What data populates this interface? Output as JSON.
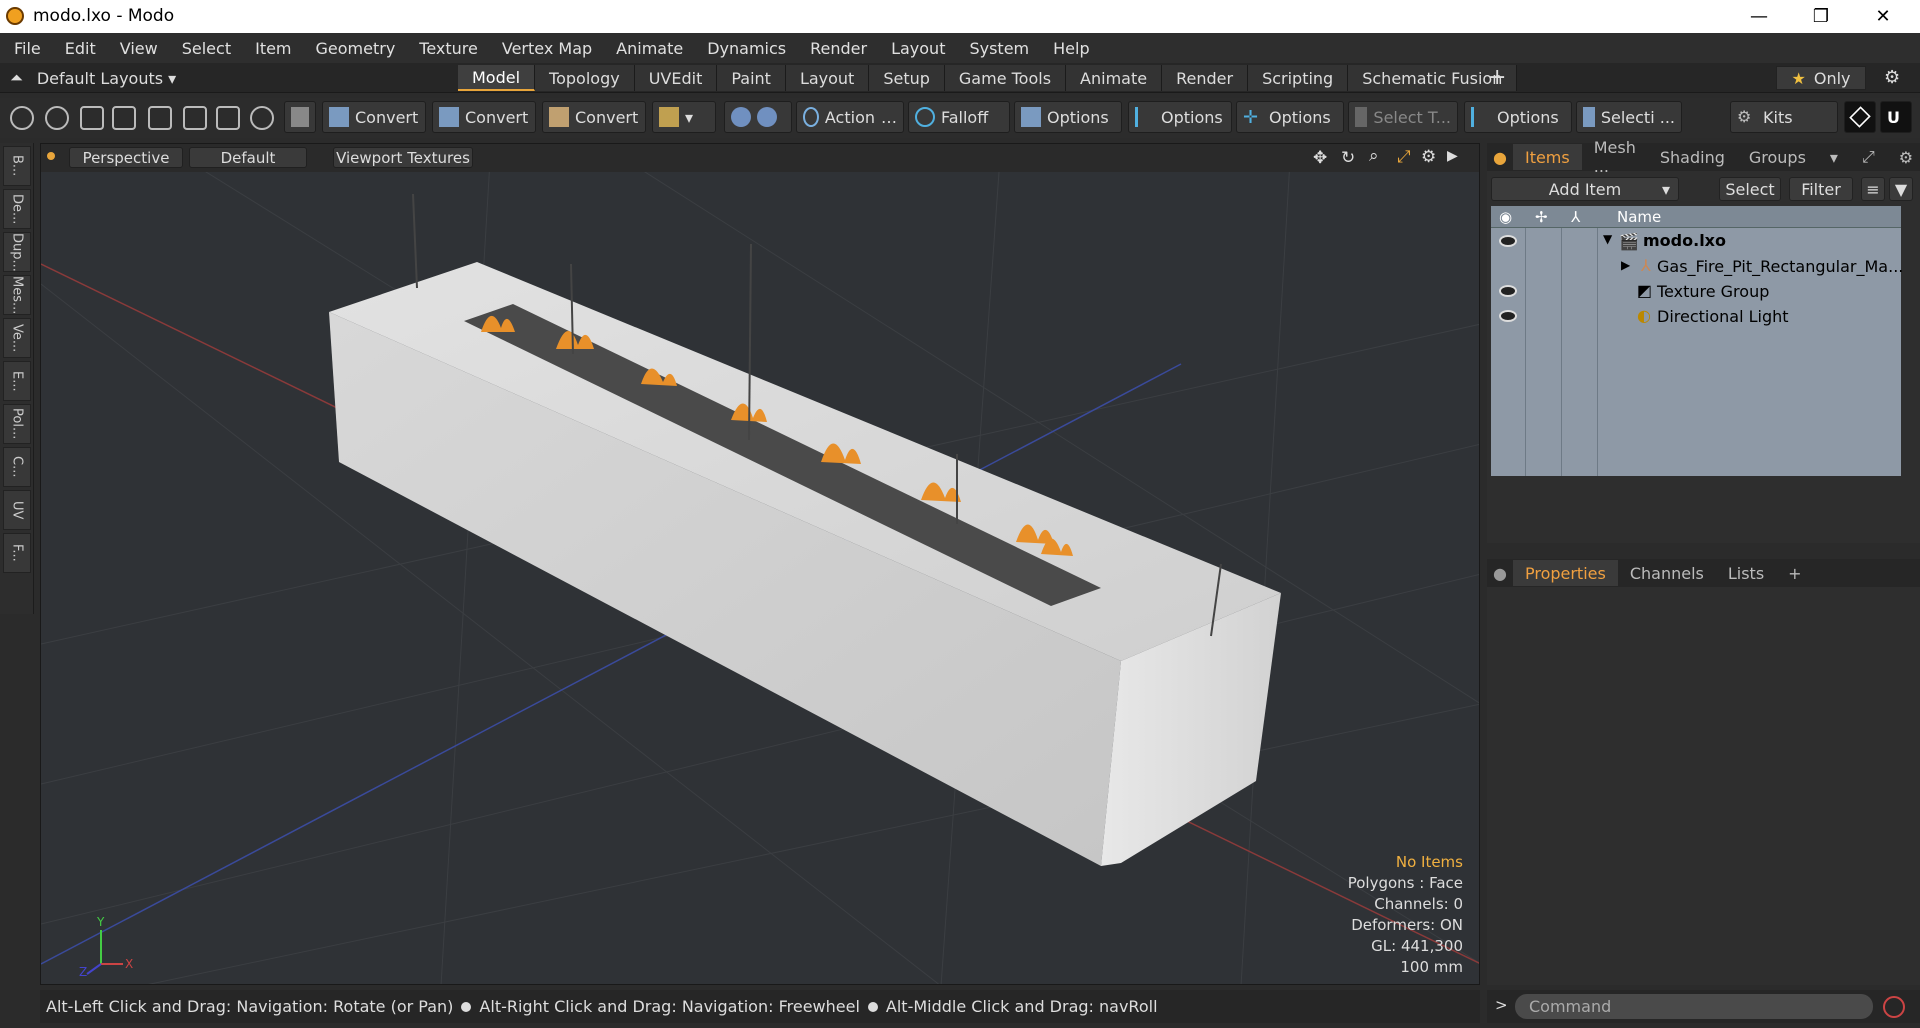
{
  "window": {
    "title": "modo.lxo - Modo",
    "minimize": "—",
    "maximize": "❐",
    "close": "✕"
  },
  "menu": [
    "File",
    "Edit",
    "View",
    "Select",
    "Item",
    "Geometry",
    "Texture",
    "Vertex Map",
    "Animate",
    "Dynamics",
    "Render",
    "Layout",
    "System",
    "Help"
  ],
  "layout": {
    "label": "Default Layouts ▾",
    "tabs": [
      "Model",
      "Topology",
      "UVEdit",
      "Paint",
      "Layout",
      "Setup",
      "Game Tools",
      "Animate",
      "Render",
      "Scripting",
      "Schematic Fusion"
    ],
    "active_tab": "Model",
    "plus": "+",
    "only": "Only"
  },
  "toolbar": {
    "convert1": "Convert",
    "convert2": "Convert",
    "convert3": "Convert",
    "action": "Action",
    "falloff": "Falloff",
    "options1": "Options",
    "options2": "Options",
    "options3": "Options",
    "select_t": "Select T...",
    "options4": "Options",
    "selecti": "Selecti ...",
    "kits": "Kits"
  },
  "left_strip": [
    "B...",
    "De...",
    "Dup...",
    "Mes...",
    "Ve...",
    "E...",
    "Pol...",
    "C...",
    "UV",
    "F..."
  ],
  "viewport": {
    "view": "Perspective",
    "shading": "Default",
    "textures": "Viewport Textures",
    "stats": {
      "items": "No Items",
      "polygons": "Polygons : Face",
      "channels": "Channels: 0",
      "deformers": "Deformers: ON",
      "gl": "GL: 441,300",
      "scale": "100 mm"
    }
  },
  "status": {
    "hint1": "Alt-Left Click and Drag: Navigation: Rotate (or Pan)",
    "hint2": "Alt-Right Click and Drag: Navigation: Freewheel",
    "hint3": "Alt-Middle Click and Drag: navRoll"
  },
  "items_panel": {
    "tabs": [
      "Items",
      "Mesh ...",
      "Shading",
      "Groups"
    ],
    "add_item": "Add Item",
    "select": "Select",
    "filter": "Filter",
    "col_name": "Name",
    "tree": [
      {
        "label": "modo.lxo"
      },
      {
        "label": "Gas_Fire_Pit_Rectangular_Ma..."
      },
      {
        "label": "Texture Group"
      },
      {
        "label": "Directional Light"
      }
    ]
  },
  "props_panel": {
    "tabs": [
      "Properties",
      "Channels",
      "Lists"
    ],
    "plus": "+"
  },
  "command": {
    "placeholder": "Command",
    "prompt": ">"
  },
  "colors": {
    "accent": "#e8a53b",
    "tree_bg": "#8e99a6"
  }
}
